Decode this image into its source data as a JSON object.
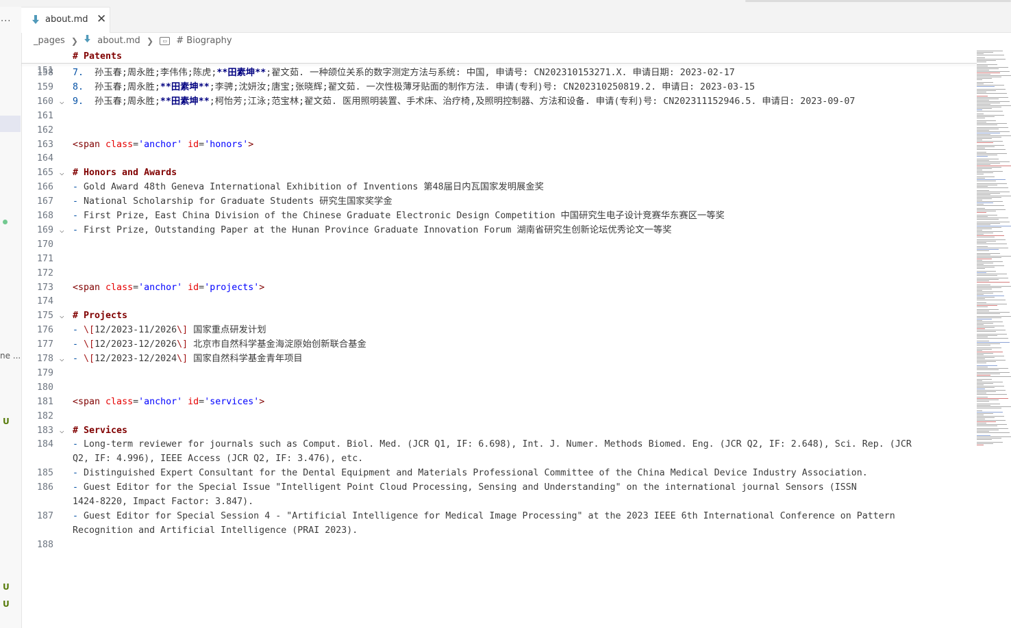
{
  "tab": {
    "title": "about.md",
    "close_label": "✕"
  },
  "breadcrumb": {
    "folder": "_pages",
    "file": "about.md",
    "symbol": "# Biography"
  },
  "sidebar": {
    "more_label": "···",
    "truncated_label": "ne ...",
    "untracked_badges": [
      "U",
      "U",
      "U"
    ]
  },
  "sticky": {
    "number": "151",
    "text": "# Patents"
  },
  "lines": [
    {
      "n": "158",
      "fold": "",
      "segs": [
        {
          "t": "7.  ",
          "c": "ol"
        },
        {
          "t": "孙玉春;周永胜;李伟伟;陈虎;"
        },
        {
          "t": "**田素坤**",
          "c": "bold"
        },
        {
          "t": ";翟文茹. 一种颌位关系的数字测定方法与系统: 中国, 申请号: CN202310153271.X. 申请日期: 2023-02-17"
        }
      ]
    },
    {
      "n": "159",
      "fold": "",
      "segs": [
        {
          "t": "8.  ",
          "c": "ol"
        },
        {
          "t": "孙玉春;周永胜;"
        },
        {
          "t": "**田素坤**",
          "c": "bold"
        },
        {
          "t": ";李骋;沈妍汝;唐宝;张晓辉;翟文茹. 一次性极薄牙贴面的制作方法. 申请(专利)号: CN202310250819.2. 申请日: 2023-03-15"
        }
      ]
    },
    {
      "n": "160",
      "fold": "v",
      "segs": [
        {
          "t": "9.  ",
          "c": "ol"
        },
        {
          "t": "孙玉春;周永胜;"
        },
        {
          "t": "**田素坤**",
          "c": "bold"
        },
        {
          "t": ";柯怡芳;江泳;范宝林;翟文茹. 医用照明装置、手术床、治疗椅,及照明控制器、方法和设备. 申请(专利)号: CN202311152946.5. 申请日: 2023-09-07"
        }
      ]
    },
    {
      "n": "161",
      "fold": "",
      "segs": []
    },
    {
      "n": "162",
      "fold": "",
      "segs": []
    },
    {
      "n": "163",
      "fold": "",
      "segs": [
        {
          "t": "<span",
          "c": "tag"
        },
        {
          "t": " "
        },
        {
          "t": "class",
          "c": "attr"
        },
        {
          "t": "="
        },
        {
          "t": "'anchor'",
          "c": "str"
        },
        {
          "t": " "
        },
        {
          "t": "id",
          "c": "attr"
        },
        {
          "t": "="
        },
        {
          "t": "'honors'",
          "c": "str"
        },
        {
          "t": ">",
          "c": "tag"
        }
      ]
    },
    {
      "n": "164",
      "fold": "",
      "segs": []
    },
    {
      "n": "165",
      "fold": "v",
      "segs": [
        {
          "t": "# Honors and Awards",
          "c": "heading"
        }
      ]
    },
    {
      "n": "166",
      "fold": "",
      "segs": [
        {
          "t": "- ",
          "c": "ol"
        },
        {
          "t": "Gold Award 48th Geneva International Exhibition of Inventions 第48届日内瓦国家发明展金奖"
        }
      ]
    },
    {
      "n": "167",
      "fold": "",
      "segs": [
        {
          "t": "- ",
          "c": "ol"
        },
        {
          "t": "National Scholarship for Graduate Students 研究生国家奖学金"
        }
      ]
    },
    {
      "n": "168",
      "fold": "",
      "segs": [
        {
          "t": "- ",
          "c": "ol"
        },
        {
          "t": "First Prize, East China Division of the Chinese Graduate Electronic Design Competition 中国研究生电子设计竞赛华东赛区一等奖"
        }
      ]
    },
    {
      "n": "169",
      "fold": "v",
      "segs": [
        {
          "t": "- ",
          "c": "ol"
        },
        {
          "t": "First Prize, Outstanding Paper at the Hunan Province Graduate Innovation Forum 湖南省研究生创新论坛优秀论文一等奖"
        }
      ]
    },
    {
      "n": "170",
      "fold": "",
      "segs": []
    },
    {
      "n": "171",
      "fold": "",
      "segs": []
    },
    {
      "n": "172",
      "fold": "",
      "segs": []
    },
    {
      "n": "173",
      "fold": "",
      "segs": [
        {
          "t": "<span",
          "c": "tag"
        },
        {
          "t": " "
        },
        {
          "t": "class",
          "c": "attr"
        },
        {
          "t": "="
        },
        {
          "t": "'anchor'",
          "c": "str"
        },
        {
          "t": " "
        },
        {
          "t": "id",
          "c": "attr"
        },
        {
          "t": "="
        },
        {
          "t": "'projects'",
          "c": "str"
        },
        {
          "t": ">",
          "c": "tag"
        }
      ]
    },
    {
      "n": "174",
      "fold": "",
      "segs": []
    },
    {
      "n": "175",
      "fold": "v",
      "segs": [
        {
          "t": "# Projects",
          "c": "heading"
        }
      ]
    },
    {
      "n": "176",
      "fold": "",
      "segs": [
        {
          "t": "- ",
          "c": "ol"
        },
        {
          "t": "\\[",
          "c": "esc"
        },
        {
          "t": "12/2023-11/2026"
        },
        {
          "t": "\\]",
          "c": "esc"
        },
        {
          "t": " 国家重点研发计划"
        }
      ]
    },
    {
      "n": "177",
      "fold": "",
      "segs": [
        {
          "t": "- ",
          "c": "ol"
        },
        {
          "t": "\\[",
          "c": "esc"
        },
        {
          "t": "12/2023-12/2026"
        },
        {
          "t": "\\]",
          "c": "esc"
        },
        {
          "t": " 北京市自然科学基金海淀原始创新联合基金"
        }
      ]
    },
    {
      "n": "178",
      "fold": "v",
      "segs": [
        {
          "t": "- ",
          "c": "ol"
        },
        {
          "t": "\\[",
          "c": "esc"
        },
        {
          "t": "12/2023-12/2024"
        },
        {
          "t": "\\]",
          "c": "esc"
        },
        {
          "t": " 国家自然科学基金青年项目"
        }
      ]
    },
    {
      "n": "179",
      "fold": "",
      "segs": []
    },
    {
      "n": "180",
      "fold": "",
      "segs": []
    },
    {
      "n": "181",
      "fold": "",
      "segs": [
        {
          "t": "<span",
          "c": "tag"
        },
        {
          "t": " "
        },
        {
          "t": "class",
          "c": "attr"
        },
        {
          "t": "="
        },
        {
          "t": "'anchor'",
          "c": "str"
        },
        {
          "t": " "
        },
        {
          "t": "id",
          "c": "attr"
        },
        {
          "t": "="
        },
        {
          "t": "'services'",
          "c": "str"
        },
        {
          "t": ">",
          "c": "tag"
        }
      ]
    },
    {
      "n": "182",
      "fold": "",
      "segs": []
    },
    {
      "n": "183",
      "fold": "v",
      "segs": [
        {
          "t": "# Services",
          "c": "heading"
        }
      ]
    },
    {
      "n": "184",
      "fold": "",
      "segs": [
        {
          "t": "- ",
          "c": "ol"
        },
        {
          "t": "Long-term reviewer for journals such as Comput. Biol. Med. (JCR Q1, IF: 6.698), Int. J. Numer. Methods Biomed. Eng. (JCR Q2, IF: 2.648), Sci. Rep. (JCR"
        }
      ]
    },
    {
      "n": "",
      "fold": "",
      "segs": [
        {
          "t": "Q2, IF: 4.996), IEEE Access (JCR Q2, IF: 3.476), etc."
        }
      ]
    },
    {
      "n": "185",
      "fold": "",
      "segs": [
        {
          "t": "- ",
          "c": "ol"
        },
        {
          "t": "Distinguished Expert Consultant for the Dental Equipment and Materials Professional Committee of the China Medical Device Industry Association."
        }
      ]
    },
    {
      "n": "186",
      "fold": "",
      "segs": [
        {
          "t": "- ",
          "c": "ol"
        },
        {
          "t": "Guest Editor for the Special Issue \"Intelligent Point Cloud Processing, Sensing and Understanding\" on the international journal Sensors (ISSN"
        }
      ]
    },
    {
      "n": "",
      "fold": "",
      "segs": [
        {
          "t": "1424-8220, Impact Factor: 3.847)."
        }
      ]
    },
    {
      "n": "187",
      "fold": "",
      "segs": [
        {
          "t": "- ",
          "c": "ol"
        },
        {
          "t": "Guest Editor for Special Session 4 - \"Artificial Intelligence for Medical Image Processing\" at the 2023 IEEE 6th International Conference on Pattern"
        }
      ]
    },
    {
      "n": "",
      "fold": "",
      "segs": [
        {
          "t": "Recognition and Artificial Intelligence (PRAI 2023)."
        }
      ]
    },
    {
      "n": "188",
      "fold": "",
      "segs": []
    }
  ]
}
